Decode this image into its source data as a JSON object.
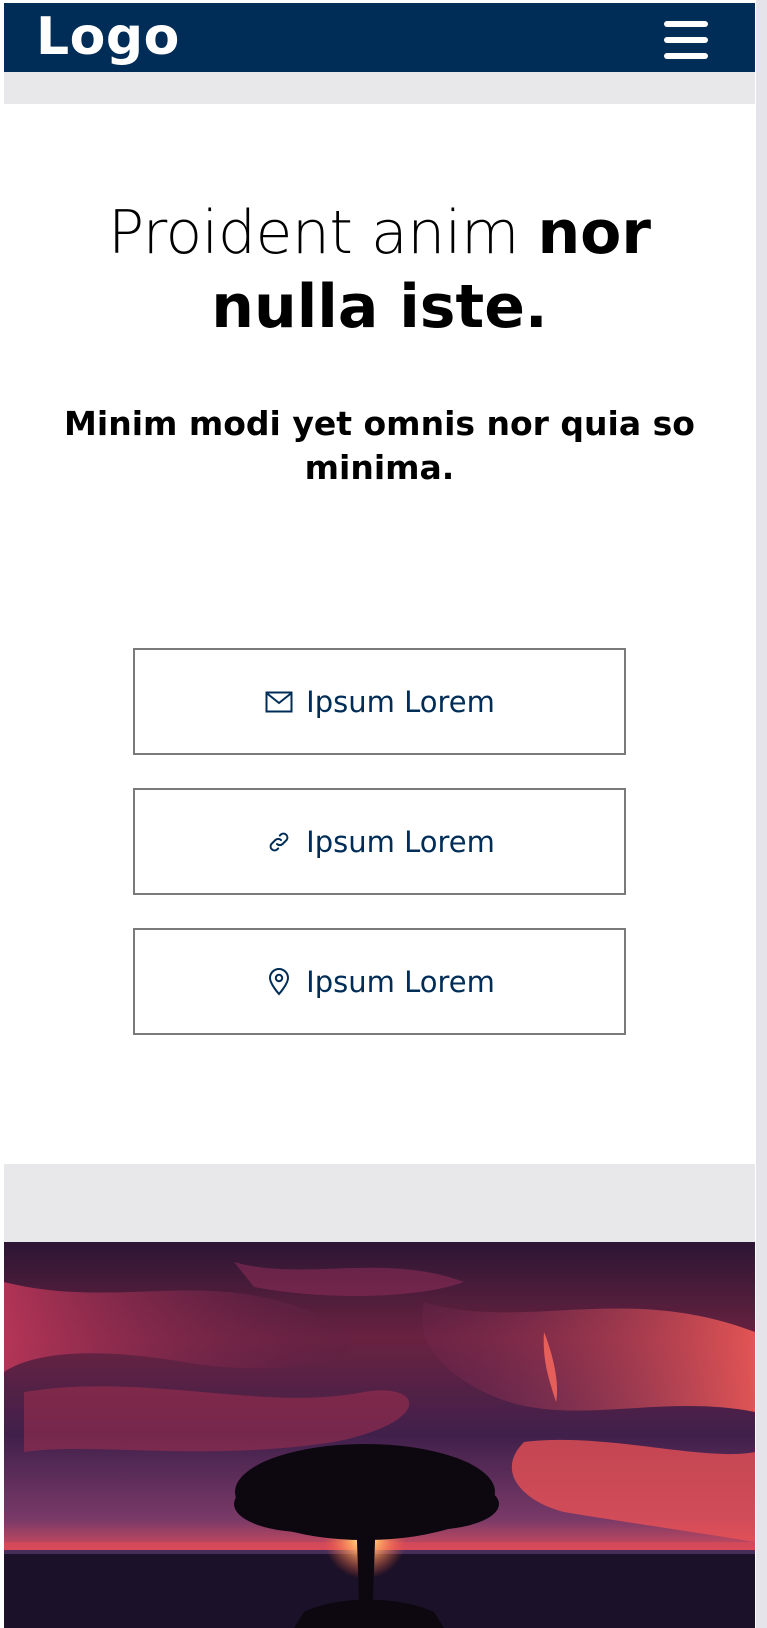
{
  "header": {
    "logo": "Logo",
    "menu_icon": "hamburger-menu-icon"
  },
  "hero": {
    "headline_light": "Proident anim ",
    "headline_bold": "nor nulla iste.",
    "subheadline": "Minim modi yet omnis nor quia so minima."
  },
  "buttons": [
    {
      "label": "Ipsum Lorem",
      "icon": "mail-icon"
    },
    {
      "label": "Ipsum Lorem",
      "icon": "link-icon"
    },
    {
      "label": "Ipsum Lorem",
      "icon": "map-pin-icon"
    }
  ],
  "banner": {
    "image": "sunset-tree-landscape"
  },
  "colors": {
    "nav_background": "#002d57",
    "button_text": "#002d57",
    "section_gap": "#e8e8ea"
  }
}
